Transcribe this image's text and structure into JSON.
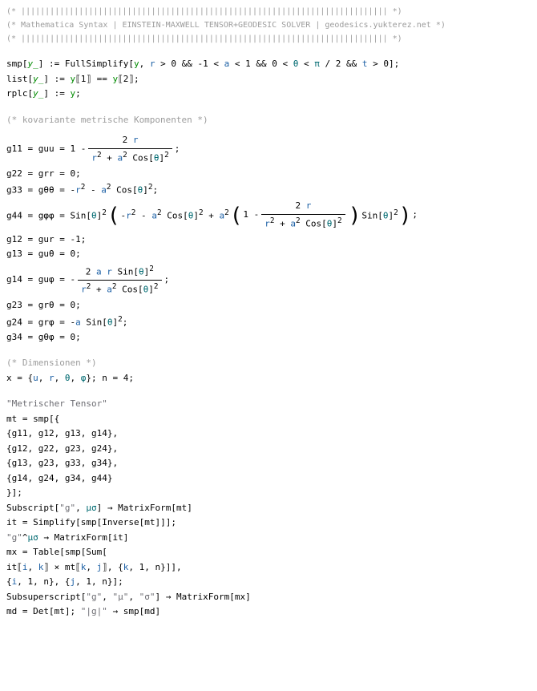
{
  "header": {
    "border": "(* |||||||||||||||||||||||||||||||||||||||||||||||||||||||||||||||||||||||||||| *)",
    "title": "(*  Mathematica Syntax | EINSTEIN-MAXWELL TENSOR+GEODESIC SOLVER | geodesics.yukterez.net *)",
    "border2": "(* |||||||||||||||||||||||||||||||||||||||||||||||||||||||||||||||||||||||||||| *)"
  },
  "fn": {
    "full_simplify": "FullSimplify",
    "sin": "Sin",
    "cos": "Cos",
    "inverse": "Inverse",
    "simplify": "Simplify",
    "subscript": "Subscript",
    "subsuperscript": "Subsuperscript",
    "sum": "Sum",
    "table": "Table",
    "matrixform": "MatrixForm",
    "det": "Det"
  },
  "def": {
    "smp": "smp",
    "list": "list",
    "rplc": "rplc",
    "mt": "mt",
    "it": "it",
    "mx": "mx",
    "md": "md"
  },
  "var": {
    "y": "y",
    "y_": "y_",
    "r": "r",
    "a": "a",
    "t": "t",
    "u": "u",
    "theta": "θ",
    "phi": "φ",
    "pi": "π",
    "mu": "μ",
    "sigma": "σ",
    "i": "i",
    "j": "j",
    "k": "k",
    "n": "n",
    "x": "x"
  },
  "num": {
    "zero": "0",
    "one": "1",
    "two": "2",
    "four": "4",
    "neg1": "-1"
  },
  "comment": {
    "kov": "(* kovariante metrische Komponenten *)",
    "dim": "(* Dimensionen *)"
  },
  "string": {
    "metrischer": "\"Metrischer Tensor\"",
    "g": "\"g\"",
    "mu": "\"μ\"",
    "sigma": "\"σ\"",
    "g_caret": "\"g\"",
    "abs_g": "\"|g|\""
  },
  "metric": {
    "g11": "g11",
    "guu": "guu",
    "g22": "g22",
    "grr": "grr",
    "g33": "g33",
    "gthth": "gθθ",
    "g44": "g44",
    "gphph": "gφφ",
    "g12": "g12",
    "gur": "gur",
    "g13": "g13",
    "guth": "guθ",
    "g14": "g14",
    "guph": "guφ",
    "g23": "g23",
    "grth": "grθ",
    "g24": "g24",
    "grph": "grφ",
    "g34": "g34",
    "gthph": "gθφ"
  },
  "op": {
    "assign": " := ",
    "eq": " = ",
    "arrow": " → ",
    "gt": " > ",
    "lt": " < ",
    "and": " && ",
    "semi": ";",
    "comma": ", ",
    "minus": " - ",
    "plus": " + ",
    "times": " × ",
    "same": " == ",
    "open_bracket": "[",
    "close_bracket": "]",
    "open_part": "⟦",
    "close_part": "⟧",
    "open_brace": "{",
    "close_brace": "}",
    "lparen": "(",
    "rparen": ")",
    "caret": "^"
  }
}
